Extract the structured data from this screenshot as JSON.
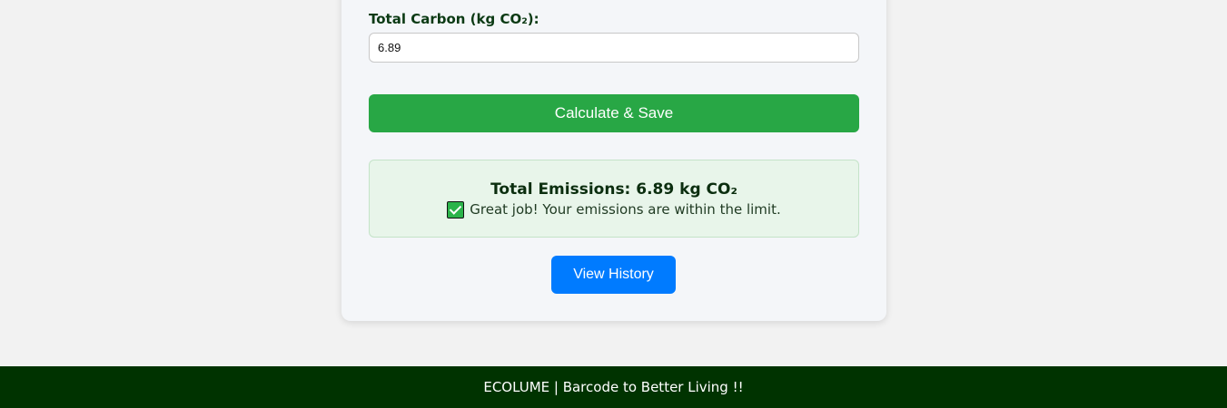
{
  "form": {
    "total_carbon_label": "Total Carbon (kg CO₂):",
    "total_carbon_value": "6.89",
    "calculate_button": "Calculate & Save"
  },
  "result": {
    "title": "Total Emissions: 6.89 kg CO₂",
    "message": "Great job! Your emissions are within the limit.",
    "status_icon": "check-icon",
    "status_color": "#2bb34a"
  },
  "history_button": "View History",
  "footer": {
    "text": "ECOLUME | Barcode to Better Living !!"
  },
  "colors": {
    "calculate_button": "#28a745",
    "history_button": "#007bff",
    "footer_background": "#003300",
    "result_background": "#e8f5ea"
  }
}
